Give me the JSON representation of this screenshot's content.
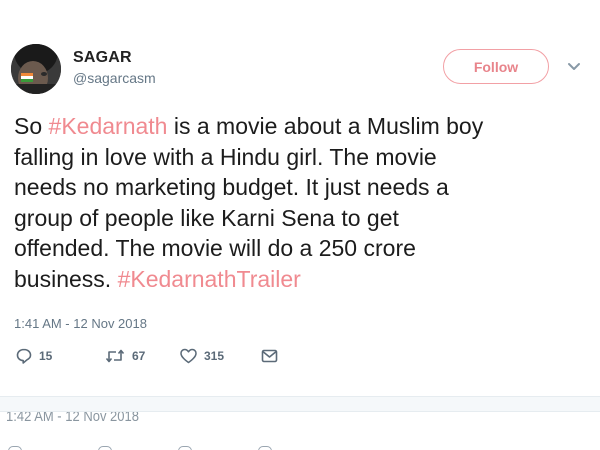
{
  "user": {
    "display_name": "SAGAR",
    "handle": "@sagarcasm",
    "avatar_icon": "profile-photo-with-flag-face-paint"
  },
  "follow_label": "Follow",
  "tweet": {
    "lines": [
      [
        "So ",
        "#Kedarnath",
        " is a movie about a Muslim boy"
      ],
      [
        "falling in love with a Hindu girl. The movie"
      ],
      [
        "needs no marketing budget. It just needs a"
      ],
      [
        "group of people like Karni Sena to get"
      ],
      [
        "offended. The movie will do a 250 crore"
      ],
      [
        "business. ",
        "#KedarnathTrailer"
      ]
    ],
    "timestamp": "1:41 AM - 12 Nov 2018",
    "hashtag_color": "#f08a90"
  },
  "actions": {
    "reply": {
      "icon": "reply-icon",
      "count": "15"
    },
    "retweet": {
      "icon": "retweet-icon",
      "count": "67"
    },
    "like": {
      "icon": "heart-icon",
      "count": "315"
    },
    "message": {
      "icon": "direct-message-icon"
    }
  },
  "next_tweet": {
    "timestamp": "1:42 AM - 12 Nov 2018"
  },
  "colors": {
    "accent": "#f08a90",
    "text": "#1c1c1c",
    "muted": "#657786"
  }
}
